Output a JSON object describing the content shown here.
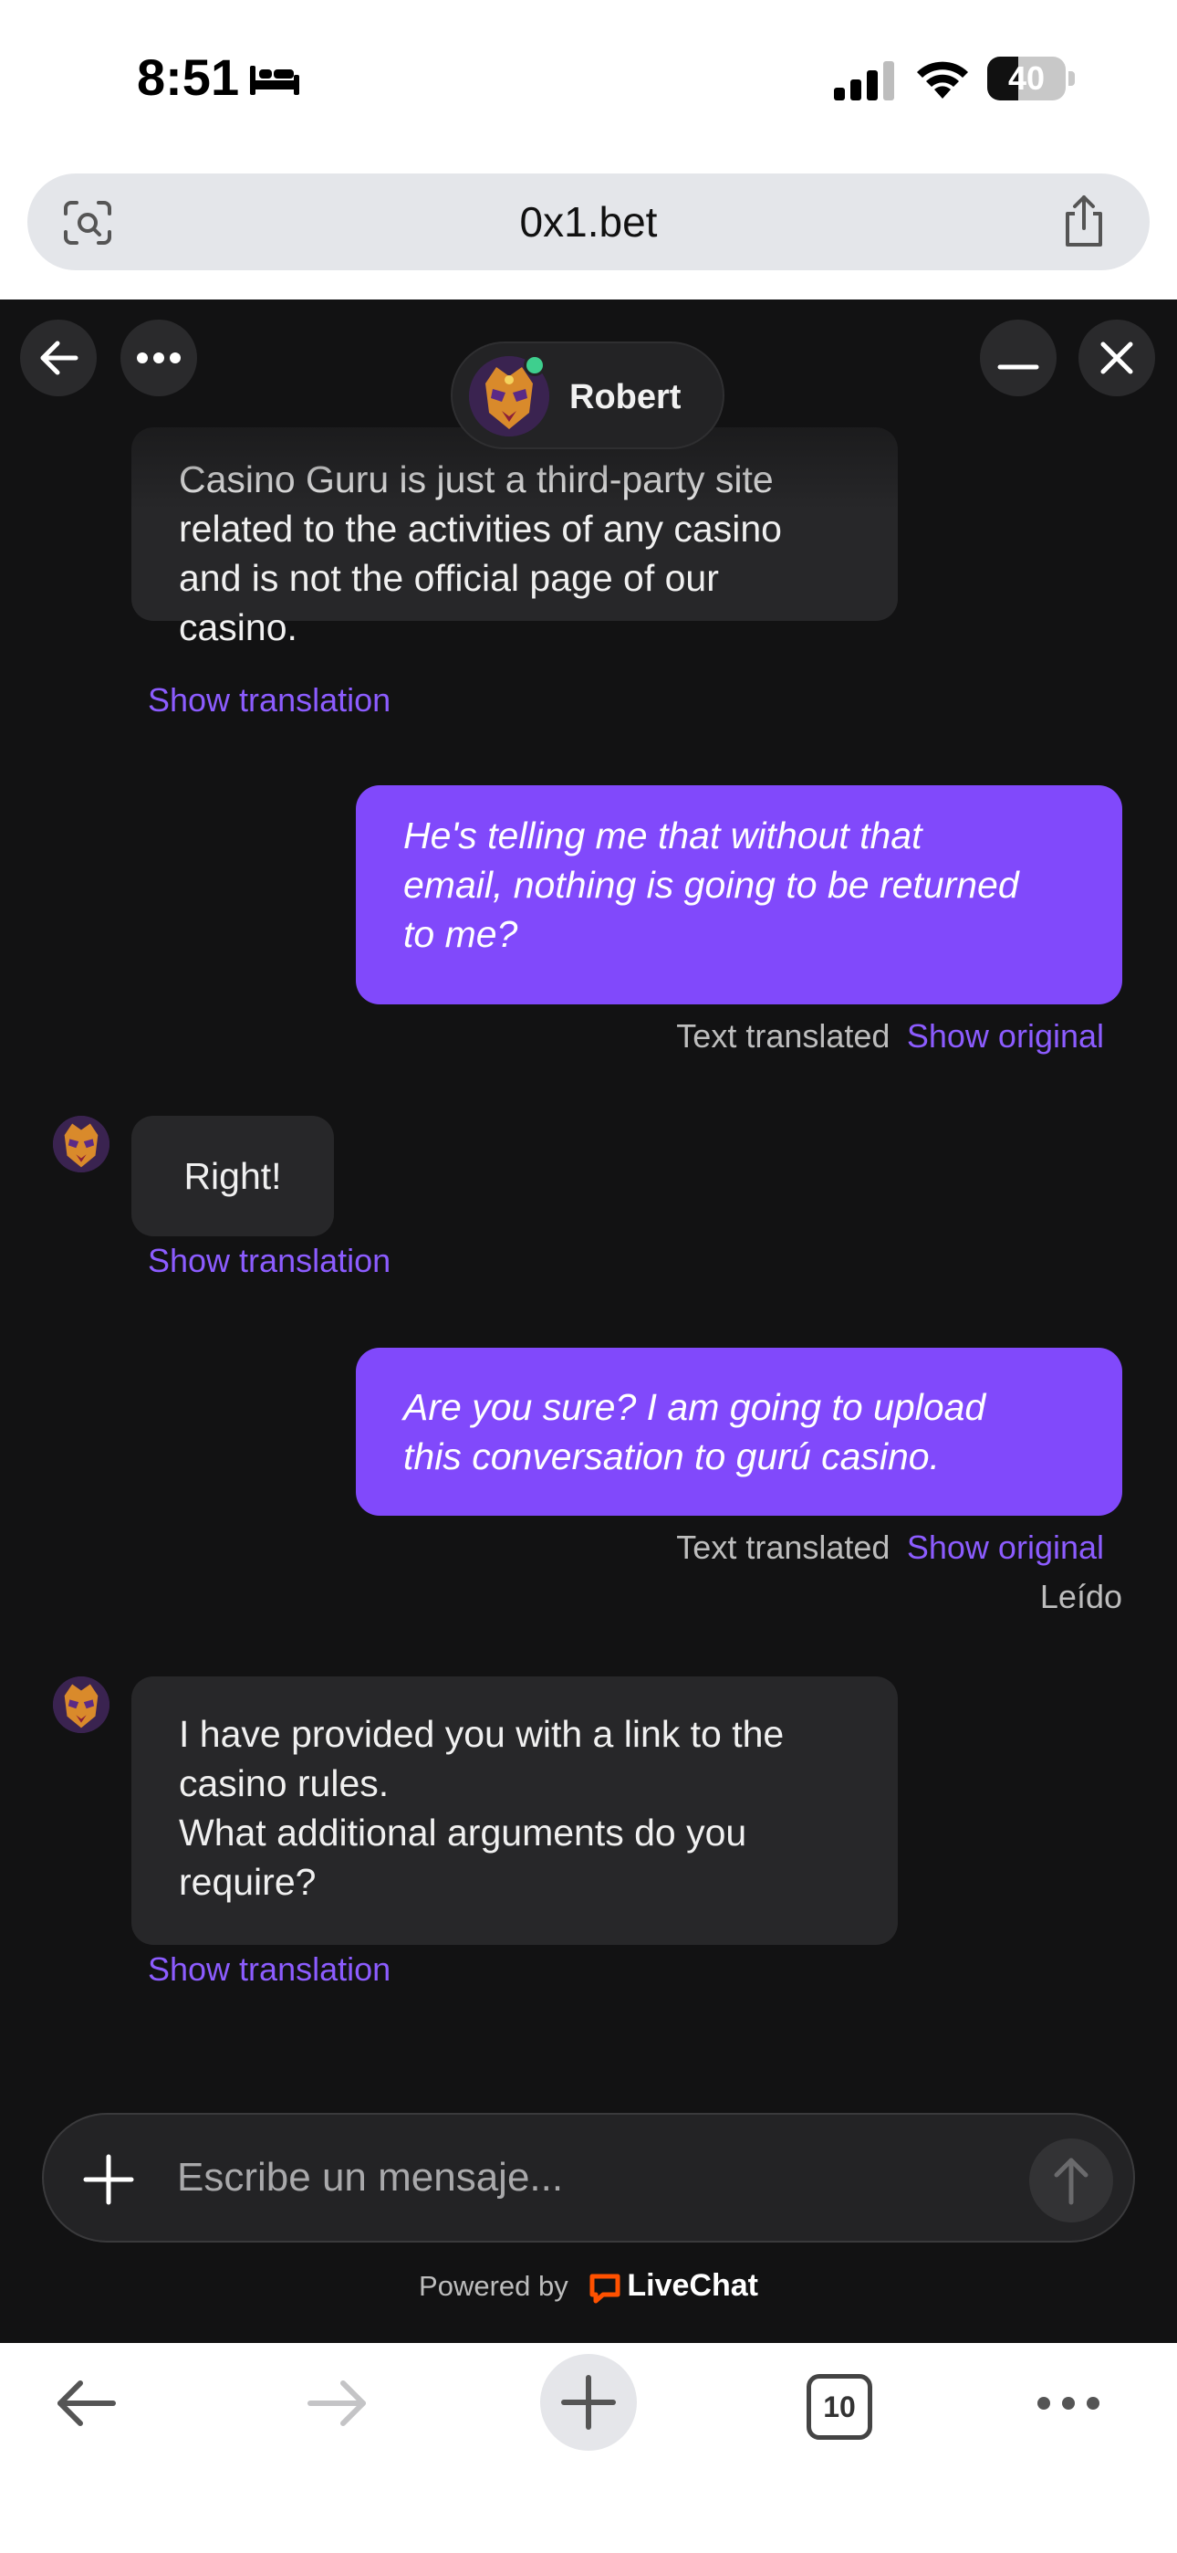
{
  "status_bar": {
    "time": "8:51",
    "battery_level": "40",
    "icons": [
      "bed-icon",
      "signal-icon",
      "wifi-icon",
      "battery-icon"
    ]
  },
  "browser": {
    "url": "0x1.bet",
    "icons": [
      "lens-icon",
      "share-icon"
    ]
  },
  "chat_header": {
    "agent_name": "Robert",
    "agent_status": "online",
    "icons": [
      "back-arrow-icon",
      "more-dots-icon",
      "minimize-icon",
      "close-icon"
    ]
  },
  "messages": [
    {
      "side": "agent",
      "lines": [
        "Casino Guru is just a third-party site",
        "related to the activities of any casino",
        "and is not the official page of our",
        "casino."
      ],
      "action": "Show translation"
    },
    {
      "side": "user",
      "lines": [
        "He's telling me that without that",
        "email, nothing is going to be returned",
        "to me?"
      ],
      "meta": "Text translated",
      "action": "Show original"
    },
    {
      "side": "agent",
      "lines": [
        "Right!"
      ],
      "action": "Show translation"
    },
    {
      "side": "user",
      "lines": [
        "Are you sure? I am going to upload",
        "this conversation to gurú casino."
      ],
      "meta": "Text translated",
      "action": "Show original",
      "read_receipt": "Leído"
    },
    {
      "side": "agent",
      "lines": [
        "I have provided you with a link to the",
        "casino rules.",
        "What additional arguments do you",
        "require?"
      ],
      "action": "Show translation"
    }
  ],
  "composer": {
    "placeholder": "Escribe un mensaje...",
    "icons": [
      "plus-icon",
      "send-arrow-icon"
    ]
  },
  "footer": {
    "powered_by": "Powered by",
    "brand": "LiveChat"
  },
  "toolbar": {
    "tabs_count": "10",
    "icons": [
      "back-icon",
      "forward-icon",
      "new-tab-icon",
      "tabs-icon",
      "more-icon"
    ]
  },
  "colors": {
    "chat_bg": "#121213",
    "user_bubble": "#8149fb",
    "agent_bubble": "#272729",
    "link": "#8c5cff",
    "online": "#3ecf8e",
    "livechat_orange": "#ff5100"
  }
}
